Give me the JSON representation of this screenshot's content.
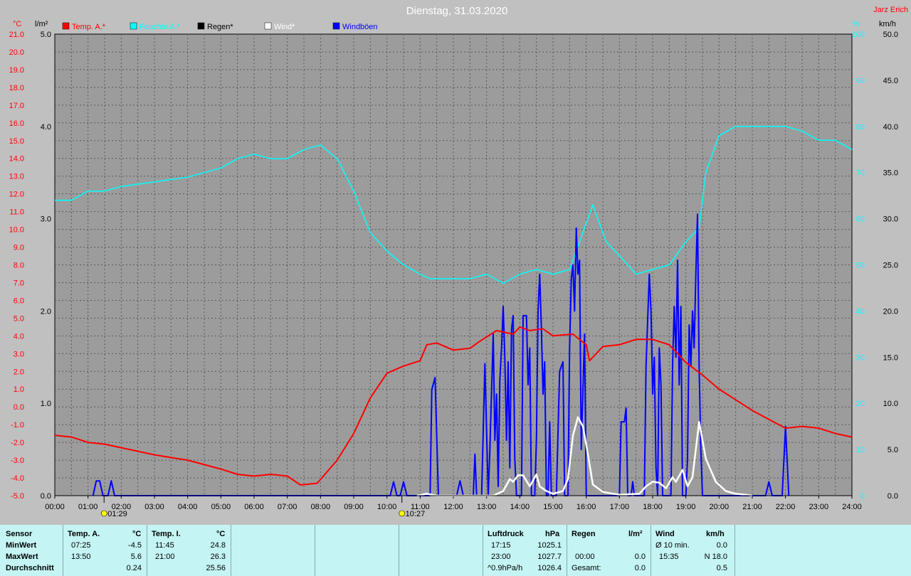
{
  "title": "Dienstag, 31.03.2020",
  "author": "Jarz Erich",
  "axis_units": {
    "temp": "°C",
    "rain": "l/m²",
    "humidity": "%",
    "wind": "km/h"
  },
  "legend": [
    {
      "label": "Temp. A.*",
      "color": "#ff0000"
    },
    {
      "label": "Feuchte A.*",
      "color": "#00ffff"
    },
    {
      "label": "Regen*",
      "color": "#000000"
    },
    {
      "label": "Wind*",
      "color": "#ffffff"
    },
    {
      "label": "Windböen",
      "color": "#0000ff"
    }
  ],
  "markers": [
    {
      "time": "01:29",
      "icon": "sunrise-moon-icon"
    },
    {
      "time": "10:27",
      "icon": "sunset-moon-icon"
    }
  ],
  "chart_data": {
    "type": "line",
    "title": "Dienstag, 31.03.2020",
    "x_ticks": [
      "00:00",
      "01:00",
      "02:00",
      "03:00",
      "04:00",
      "05:00",
      "06:00",
      "07:00",
      "08:00",
      "09:00",
      "10:00",
      "11:00",
      "12:00",
      "13:00",
      "14:00",
      "15:00",
      "16:00",
      "17:00",
      "18:00",
      "19:00",
      "20:00",
      "21:00",
      "22:00",
      "23:00",
      "24:00"
    ],
    "xlim": [
      0,
      24
    ],
    "axes": {
      "temp": {
        "range": [
          -5,
          21
        ],
        "ticks": [
          "21.0",
          "20.0",
          "19.0",
          "18.0",
          "17.0",
          "16.0",
          "15.0",
          "14.0",
          "13.0",
          "12.0",
          "11.0",
          "10.0",
          "9.0",
          "8.0",
          "7.0",
          "6.0",
          "5.0",
          "4.0",
          "3.0",
          "2.0",
          "1.0",
          "0.0",
          "-1.0",
          "-2.0",
          "-3.0",
          "-4.0",
          "-5.0"
        ]
      },
      "rain": {
        "range": [
          0,
          5
        ],
        "ticks": [
          "5.0",
          "4.0",
          "3.0",
          "2.0",
          "1.0",
          "0.0"
        ]
      },
      "humidity": {
        "range": [
          0,
          100
        ],
        "ticks": [
          "100",
          "90",
          "80",
          "70",
          "60",
          "50",
          "40",
          "30",
          "20",
          "10",
          "0"
        ]
      },
      "wind": {
        "range": [
          0,
          50
        ],
        "ticks": [
          "50.0",
          "45.0",
          "40.0",
          "35.0",
          "30.0",
          "25.0",
          "20.0",
          "15.0",
          "10.0",
          "5.0",
          "0.0"
        ]
      }
    },
    "series": [
      {
        "name": "Temp. A.*",
        "axis": "temp",
        "color": "#ff0000",
        "points": [
          [
            0,
            -1.6
          ],
          [
            0.5,
            -1.7
          ],
          [
            1,
            -2.0
          ],
          [
            1.5,
            -2.1
          ],
          [
            2,
            -2.3
          ],
          [
            3,
            -2.7
          ],
          [
            4,
            -3.0
          ],
          [
            5,
            -3.5
          ],
          [
            5.5,
            -3.8
          ],
          [
            6,
            -3.9
          ],
          [
            6.5,
            -3.8
          ],
          [
            7,
            -3.9
          ],
          [
            7.4,
            -4.4
          ],
          [
            7.9,
            -4.3
          ],
          [
            8.5,
            -3.0
          ],
          [
            9,
            -1.5
          ],
          [
            9.5,
            0.5
          ],
          [
            10,
            1.9
          ],
          [
            10.5,
            2.3
          ],
          [
            11,
            2.6
          ],
          [
            11.2,
            3.5
          ],
          [
            11.5,
            3.6
          ],
          [
            12,
            3.2
          ],
          [
            12.5,
            3.3
          ],
          [
            12.8,
            3.7
          ],
          [
            13.3,
            4.3
          ],
          [
            13.8,
            4.1
          ],
          [
            14,
            4.5
          ],
          [
            14.3,
            4.3
          ],
          [
            14.7,
            4.4
          ],
          [
            15,
            4.0
          ],
          [
            15.6,
            4.1
          ],
          [
            16,
            3.5
          ],
          [
            16.1,
            2.6
          ],
          [
            16.5,
            3.4
          ],
          [
            17,
            3.5
          ],
          [
            17.5,
            3.8
          ],
          [
            18,
            3.8
          ],
          [
            18.5,
            3.5
          ],
          [
            19,
            2.5
          ],
          [
            19.5,
            1.8
          ],
          [
            20,
            1.0
          ],
          [
            20.5,
            0.4
          ],
          [
            21,
            -0.2
          ],
          [
            21.5,
            -0.7
          ],
          [
            22,
            -1.2
          ],
          [
            22.5,
            -1.1
          ],
          [
            23,
            -1.2
          ],
          [
            23.5,
            -1.5
          ],
          [
            24,
            -1.7
          ]
        ]
      },
      {
        "name": "Feuchte A.*",
        "axis": "humidity",
        "color": "#00ffff",
        "points": [
          [
            0,
            64
          ],
          [
            0.5,
            64
          ],
          [
            1,
            66
          ],
          [
            1.5,
            66
          ],
          [
            2,
            67
          ],
          [
            3,
            68
          ],
          [
            4,
            69
          ],
          [
            5,
            71
          ],
          [
            5.5,
            73
          ],
          [
            6,
            74
          ],
          [
            6.5,
            73
          ],
          [
            7,
            73
          ],
          [
            7.5,
            75
          ],
          [
            8,
            76
          ],
          [
            8.5,
            73
          ],
          [
            9,
            66
          ],
          [
            9.5,
            57
          ],
          [
            10,
            53
          ],
          [
            10.5,
            50
          ],
          [
            11,
            48
          ],
          [
            11.3,
            47
          ],
          [
            12,
            47
          ],
          [
            12.5,
            47
          ],
          [
            13,
            48
          ],
          [
            13.5,
            46
          ],
          [
            14,
            48
          ],
          [
            14.5,
            49
          ],
          [
            15,
            48
          ],
          [
            15.5,
            49
          ],
          [
            15.8,
            55
          ],
          [
            16.2,
            63
          ],
          [
            16.6,
            55
          ],
          [
            17,
            52
          ],
          [
            17.5,
            48
          ],
          [
            18,
            49
          ],
          [
            18.5,
            50
          ],
          [
            19,
            55
          ],
          [
            19.4,
            58
          ],
          [
            19.6,
            70
          ],
          [
            20,
            78
          ],
          [
            20.5,
            80
          ],
          [
            21,
            80
          ],
          [
            21.5,
            80
          ],
          [
            22,
            80
          ],
          [
            22.5,
            79
          ],
          [
            23,
            77
          ],
          [
            23.5,
            77
          ],
          [
            24,
            75
          ]
        ]
      },
      {
        "name": "Regen*",
        "axis": "rain",
        "color": "#000000",
        "points": [
          [
            0,
            0
          ],
          [
            24,
            0
          ]
        ]
      },
      {
        "name": "Wind*",
        "axis": "wind",
        "color": "#ffffff",
        "points": [
          [
            10.9,
            0
          ],
          [
            11.2,
            0.2
          ],
          [
            11.5,
            0
          ],
          [
            13.2,
            0
          ],
          [
            13.5,
            0.5
          ],
          [
            13.7,
            1.8
          ],
          [
            13.8,
            1.5
          ],
          [
            13.95,
            2.2
          ],
          [
            14.1,
            2.2
          ],
          [
            14.3,
            1.0
          ],
          [
            14.5,
            2.3
          ],
          [
            14.6,
            1.0
          ],
          [
            14.8,
            0.5
          ],
          [
            15,
            0.2
          ],
          [
            15.3,
            0.5
          ],
          [
            15.45,
            1.8
          ],
          [
            15.6,
            6.5
          ],
          [
            15.75,
            8.5
          ],
          [
            15.9,
            7.5
          ],
          [
            16.05,
            4.5
          ],
          [
            16.2,
            1.2
          ],
          [
            16.5,
            0.4
          ],
          [
            17,
            0.1
          ],
          [
            17.6,
            0.2
          ],
          [
            17.8,
            1.0
          ],
          [
            18,
            1.5
          ],
          [
            18.2,
            1.4
          ],
          [
            18.4,
            0.8
          ],
          [
            18.6,
            2.0
          ],
          [
            18.7,
            1.5
          ],
          [
            18.9,
            2.8
          ],
          [
            19.05,
            1.0
          ],
          [
            19.2,
            2.0
          ],
          [
            19.4,
            8.0
          ],
          [
            19.6,
            4.0
          ],
          [
            19.9,
            1.5
          ],
          [
            20.2,
            0.5
          ],
          [
            20.5,
            0.2
          ],
          [
            20.8,
            0.1
          ],
          [
            21,
            0
          ]
        ]
      },
      {
        "name": "Windböen",
        "axis": "wind",
        "color": "#0000ff",
        "points": [
          [
            1.15,
            0
          ],
          [
            1.25,
            1.6
          ],
          [
            1.35,
            1.6
          ],
          [
            1.45,
            0
          ],
          [
            1.6,
            0
          ],
          [
            1.7,
            1.6
          ],
          [
            1.8,
            0
          ],
          [
            10.1,
            0
          ],
          [
            10.2,
            1.5
          ],
          [
            10.3,
            0
          ],
          [
            10.4,
            0
          ],
          [
            10.5,
            1.5
          ],
          [
            10.6,
            0
          ],
          [
            11.3,
            0
          ],
          [
            11.35,
            11.5
          ],
          [
            11.45,
            12.8
          ],
          [
            11.55,
            0
          ],
          [
            12.1,
            0
          ],
          [
            12.2,
            1.6
          ],
          [
            12.3,
            0
          ],
          [
            12.6,
            0
          ],
          [
            12.65,
            4.5
          ],
          [
            12.7,
            0
          ],
          [
            12.85,
            0
          ],
          [
            12.95,
            14.3
          ],
          [
            13.05,
            0
          ],
          [
            13.1,
            5.0
          ],
          [
            13.2,
            17.5
          ],
          [
            13.25,
            6.0
          ],
          [
            13.3,
            11.0
          ],
          [
            13.35,
            1.0
          ],
          [
            13.4,
            12.5
          ],
          [
            13.45,
            16.0
          ],
          [
            13.5,
            20.5
          ],
          [
            13.55,
            15.0
          ],
          [
            13.6,
            6.0
          ],
          [
            13.65,
            14.5
          ],
          [
            13.7,
            3.0
          ],
          [
            13.75,
            18.0
          ],
          [
            13.8,
            19.5
          ],
          [
            13.85,
            4.0
          ],
          [
            13.9,
            0
          ],
          [
            14.05,
            0
          ],
          [
            14.1,
            19.5
          ],
          [
            14.2,
            19.5
          ],
          [
            14.25,
            12.0
          ],
          [
            14.3,
            16.0
          ],
          [
            14.35,
            0
          ],
          [
            14.45,
            0
          ],
          [
            14.5,
            6.0
          ],
          [
            14.55,
            20.0
          ],
          [
            14.6,
            24.0
          ],
          [
            14.65,
            18.0
          ],
          [
            14.7,
            11.0
          ],
          [
            14.75,
            14.5
          ],
          [
            14.8,
            0
          ],
          [
            14.85,
            0
          ],
          [
            14.9,
            8.0
          ],
          [
            14.95,
            0
          ],
          [
            15.1,
            0
          ],
          [
            15.2,
            13.5
          ],
          [
            15.3,
            14.5
          ],
          [
            15.35,
            0
          ],
          [
            15.45,
            0
          ],
          [
            15.5,
            16.0
          ],
          [
            15.55,
            23.5
          ],
          [
            15.6,
            25.0
          ],
          [
            15.65,
            20.0
          ],
          [
            15.7,
            29.0
          ],
          [
            15.75,
            24.0
          ],
          [
            15.8,
            25.5
          ],
          [
            15.85,
            5.0
          ],
          [
            15.95,
            17.5
          ],
          [
            16.0,
            0
          ],
          [
            17.0,
            0
          ],
          [
            17.05,
            8.0
          ],
          [
            17.15,
            8.0
          ],
          [
            17.2,
            9.5
          ],
          [
            17.25,
            0
          ],
          [
            17.35,
            0
          ],
          [
            17.4,
            1.5
          ],
          [
            17.45,
            0
          ],
          [
            17.75,
            0
          ],
          [
            17.8,
            14.0
          ],
          [
            17.85,
            19.0
          ],
          [
            17.9,
            24.0
          ],
          [
            17.95,
            20.0
          ],
          [
            18.0,
            11.0
          ],
          [
            18.05,
            15.0
          ],
          [
            18.1,
            3.0
          ],
          [
            18.15,
            0
          ],
          [
            18.2,
            16.0
          ],
          [
            18.25,
            12.0
          ],
          [
            18.3,
            0
          ],
          [
            18.55,
            0
          ],
          [
            18.6,
            14.0
          ],
          [
            18.65,
            20.5
          ],
          [
            18.7,
            15.0
          ],
          [
            18.75,
            25.5
          ],
          [
            18.8,
            12.0
          ],
          [
            18.85,
            20.5
          ],
          [
            18.9,
            0
          ],
          [
            19.0,
            0
          ],
          [
            19.05,
            4.0
          ],
          [
            19.1,
            18.5
          ],
          [
            19.15,
            14.0
          ],
          [
            19.2,
            20.0
          ],
          [
            19.25,
            16.0
          ],
          [
            19.3,
            24.0
          ],
          [
            19.35,
            30.5
          ],
          [
            19.4,
            14.0
          ],
          [
            19.45,
            5.0
          ],
          [
            19.5,
            0
          ],
          [
            21.4,
            0
          ],
          [
            21.5,
            1.5
          ],
          [
            21.6,
            0
          ],
          [
            21.9,
            0
          ],
          [
            22.0,
            7.5
          ],
          [
            22.1,
            0
          ]
        ]
      }
    ]
  },
  "stats": {
    "sensor_header": "Sensor",
    "row_labels": [
      "MinWert",
      "MaxWert",
      "Durchschnitt"
    ],
    "temp_a": {
      "header": "Temp. A.",
      "unit": "°C",
      "min_time": "07:25",
      "min_val": "-4.5",
      "max_time": "13:50",
      "max_val": "5.6",
      "avg": "0.24"
    },
    "temp_i": {
      "header": "Temp. I.",
      "unit": "°C",
      "min_time": "11:45",
      "min_val": "24.8",
      "max_time": "21:00",
      "max_val": "26.3",
      "avg": "25.56"
    },
    "pressure": {
      "header": "Luftdruck",
      "unit": "hPa",
      "min_time": "17:15",
      "min_val": "1025.1",
      "max_time": "23:00",
      "max_val": "1027.7",
      "trend_label": "^0.9hPa/h",
      "trend_val": "1026.4"
    },
    "rain": {
      "header": "Regen",
      "unit": "l/m²",
      "max_time": "00:00",
      "max_val": "0.0",
      "total_label": "Gesamt:",
      "total_val": "0.0"
    },
    "wind": {
      "header": "Wind",
      "unit": "km/h",
      "avg_label": "Ø 10 min.",
      "avg_val": "0.0",
      "max_time": "15:35",
      "max_val": "N 18.0",
      "mean_val": "0.5"
    }
  }
}
